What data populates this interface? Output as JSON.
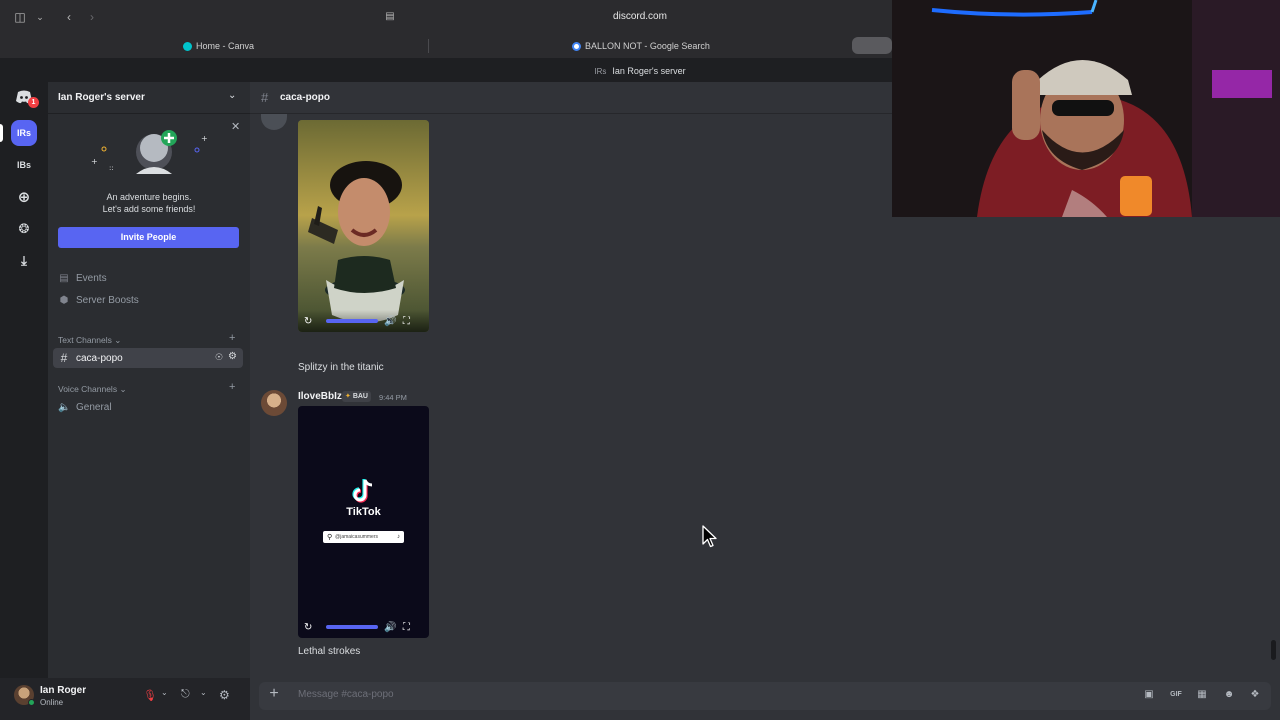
{
  "browser": {
    "url": "discord.com",
    "tabs": [
      {
        "label": "Home - Canva",
        "icon": "canva-icon"
      },
      {
        "label": "BALLON NOT - Google Search",
        "icon": "google-icon"
      }
    ],
    "page_title": "Ian Roger's server"
  },
  "rail": {
    "home_badge": "1",
    "servers": [
      "IRs",
      "IBs"
    ]
  },
  "sidebar": {
    "server_name": "Ian Roger's server",
    "welcome": {
      "line1": "An adventure begins.",
      "line2": "Let's add some friends!",
      "invite_label": "Invite People"
    },
    "items": [
      {
        "label": "Events",
        "icon": "calendar-icon"
      },
      {
        "label": "Server Boosts",
        "icon": "boost-icon"
      }
    ],
    "text_category": "Text Channels",
    "text_channels": [
      "caca-popo"
    ],
    "voice_category": "Voice Channels",
    "voice_channels": [
      "General"
    ]
  },
  "user": {
    "name": "Ian Roger",
    "status": "Online"
  },
  "chat": {
    "channel": "caca-popo",
    "messages": [
      {
        "caption": "Splitzy in the titanic"
      },
      {
        "author": "IloveBbIz",
        "badge": "BAU",
        "time": "9:44 PM",
        "media_title": "TikTok",
        "search_text": "@jamaicasummers",
        "caption": "Lethal strokes"
      }
    ],
    "composer_placeholder": "Message #caca-popo"
  },
  "colors": {
    "accent": "#5865f2",
    "online": "#23a559",
    "mute_red": "#f23f43"
  }
}
